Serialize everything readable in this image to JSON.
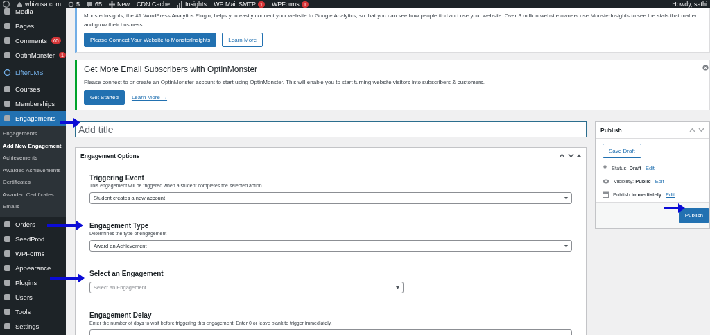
{
  "admin_bar": {
    "site": "whizusa.com",
    "updates": "5",
    "comments": "65",
    "new": "New",
    "items": [
      {
        "label": "CDN Cache",
        "kind": "plain"
      },
      {
        "label": "Insights",
        "kind": "chart"
      },
      {
        "label": "WP Mail SMTP",
        "kind": "plain",
        "badge": "1"
      },
      {
        "label": "WPForms",
        "kind": "plain",
        "badge": "1"
      }
    ],
    "account": "Howdy, sathi"
  },
  "sidebar": {
    "items": [
      {
        "label": "Media",
        "kind": "menu",
        "selected": false
      },
      {
        "label": "Pages",
        "kind": "menu",
        "selected": false
      },
      {
        "label": "Comments",
        "kind": "menu",
        "selected": false,
        "badge": "65"
      },
      {
        "label": "OptinMonster",
        "kind": "menu",
        "selected": false,
        "badge": "1"
      },
      {
        "label": "LifterLMS",
        "kind": "brand",
        "selected": false
      },
      {
        "label": "Courses",
        "kind": "menu",
        "selected": false
      },
      {
        "label": "Memberships",
        "kind": "menu",
        "selected": false
      },
      {
        "label": "Engagements",
        "kind": "menu",
        "selected": true,
        "children": [
          {
            "label": "Engagements",
            "selected": false
          },
          {
            "label": "Add New Engagement",
            "selected": true
          },
          {
            "label": "Achievements",
            "selected": false
          },
          {
            "label": "Awarded Achievements",
            "selected": false
          },
          {
            "label": "Certificates",
            "selected": false
          },
          {
            "label": "Awarded Certificates",
            "selected": false
          },
          {
            "label": "Emails",
            "selected": false
          }
        ]
      },
      {
        "label": "Orders",
        "kind": "menu",
        "selected": false
      },
      {
        "label": "SeedProd",
        "kind": "menu",
        "selected": false
      },
      {
        "label": "WPForms",
        "kind": "menu",
        "selected": false
      },
      {
        "label": "Appearance",
        "kind": "menu",
        "selected": false
      },
      {
        "label": "Plugins",
        "kind": "menu",
        "selected": false
      },
      {
        "label": "Users",
        "kind": "menu",
        "selected": false
      },
      {
        "label": "Tools",
        "kind": "menu",
        "selected": false
      },
      {
        "label": "Settings",
        "kind": "menu",
        "selected": false
      }
    ]
  },
  "notices": [
    {
      "kind": "info",
      "text": "MonsterInsights, the #1 WordPress Analytics Plugin, helps you easily connect your website to Google Analytics, so that you can see how people find and use your website. Over 3 million website owners use MonsterInsights to see the stats that matter and grow their business.",
      "buttons": [
        {
          "label": "Please Connect Your Website to MonsterInsights",
          "kind": "primary"
        },
        {
          "label": "Learn More",
          "kind": "secondary"
        }
      ]
    },
    {
      "kind": "success",
      "title": "Get More Email Subscribers with OptinMonster",
      "text": "Please connect to or create an OptinMonster account to start using OptinMonster. This will enable you to start turning website visitors into subscribers & customers.",
      "dismissible": true,
      "buttons": [
        {
          "label": "Get Started",
          "kind": "primary"
        },
        {
          "label": "Learn More →",
          "kind": "link"
        }
      ]
    }
  ],
  "title_field": {
    "placeholder": "Add title"
  },
  "engagement_options": {
    "title": "Engagement Options",
    "fields": [
      {
        "label": "Triggering Event",
        "description": "This engagement will be triggered when a student completes the selected action",
        "kind": "select",
        "value": "Student creates a new account"
      },
      {
        "label": "Engagement Type",
        "description": "Determines the type of engagement",
        "kind": "select",
        "value": "Award an Achievement"
      },
      {
        "label": "Select an Engagement",
        "kind": "select_narrow",
        "placeholder": "Select an Engagement"
      },
      {
        "label": "Engagement Delay",
        "description": "Enter the number of days to wait before triggering this engagement. Enter 0 or leave blank to trigger immediately.",
        "kind": "number"
      }
    ]
  },
  "publish": {
    "title": "Publish",
    "save_draft": "Save Draft",
    "rows": [
      {
        "kind": "status",
        "text": "Status: **Draft**",
        "link": "Edit"
      },
      {
        "kind": "visibility",
        "text": "Visibility: **Public**",
        "link": "Edit"
      },
      {
        "kind": "schedule",
        "text": "Publish **immediately**",
        "link": "Edit"
      }
    ],
    "publish_button": "Publish"
  }
}
